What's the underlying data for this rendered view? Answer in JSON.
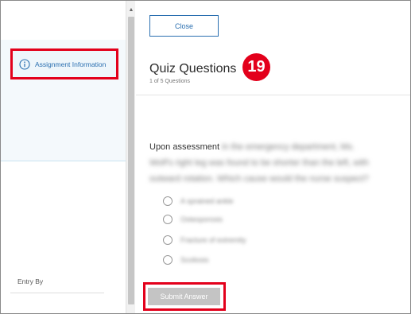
{
  "sidebar": {
    "assignment_info_label": "Assignment Information",
    "entry_by_label": "Entry By"
  },
  "main": {
    "close_label": "Close",
    "title": "Quiz Questions",
    "step_number": "19",
    "question_count": "1 of 5 Questions",
    "question_visible": "Upon assessment",
    "question_obscured": "in the emergency department, Ms. Wolf's right leg was found to be shorter than the left, with outward rotation. Which cause would the nurse suspect?",
    "options": [
      "A sprained ankle",
      "Osteoporosis",
      "Fracture of extremity",
      "Scoliosis"
    ],
    "submit_label": "Submit Answer"
  },
  "colors": {
    "accent_blue": "#2a6fb0",
    "highlight_red": "#e3001b",
    "disabled_button": "#c4c4c4"
  },
  "icons": [
    "info-icon",
    "scroll-up-arrow-icon"
  ]
}
